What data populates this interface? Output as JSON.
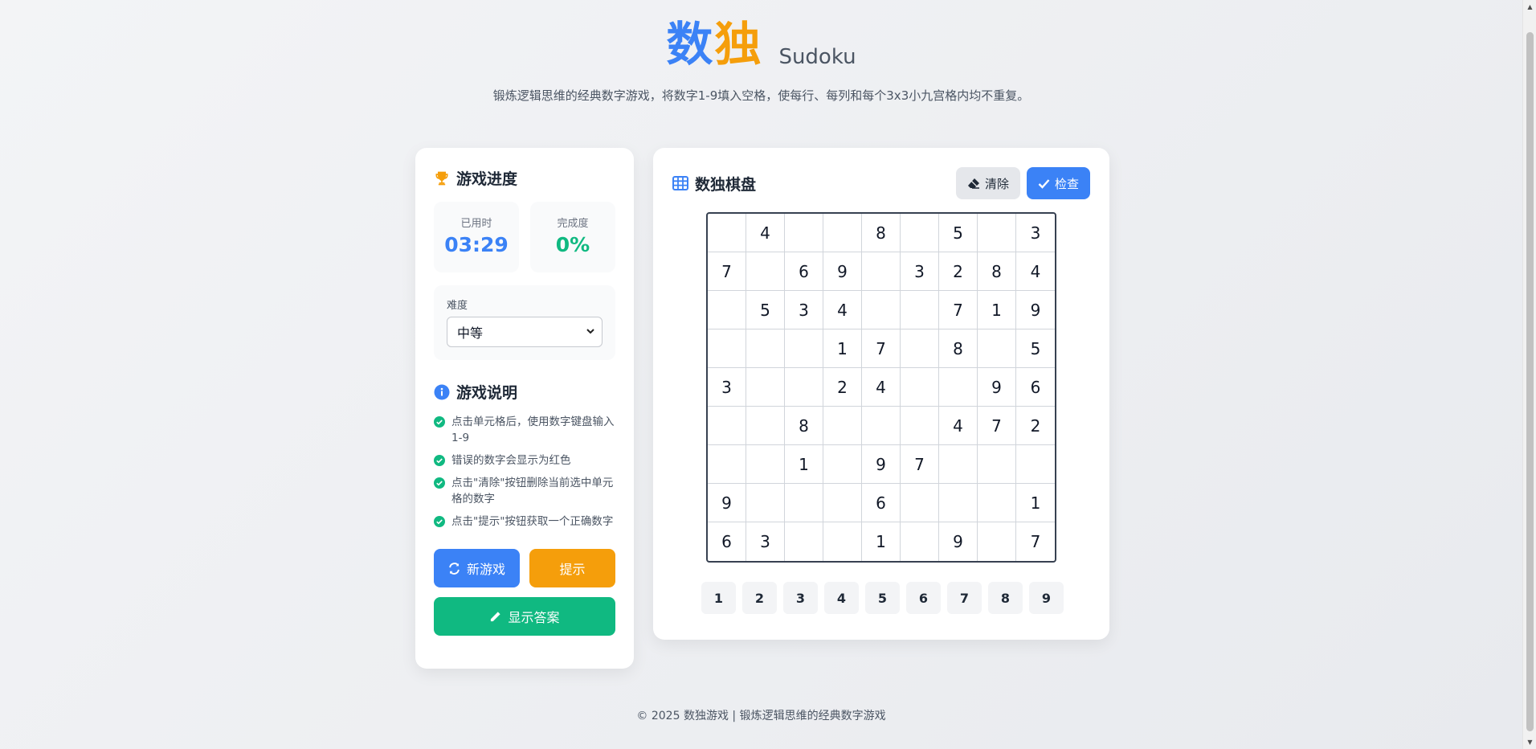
{
  "header": {
    "title_part1": "数",
    "title_part2": "独",
    "title_en": "Sudoku",
    "subtitle": "锻炼逻辑思维的经典数字游戏，将数字1-9填入空格，使每行、每列和每个3x3小九宫格内均不重复。"
  },
  "progress": {
    "title": "游戏进度",
    "icon": "trophy-icon",
    "time_label": "已用时",
    "time_value": "03:29",
    "completion_label": "完成度",
    "completion_value": "0%",
    "completion_fraction": 0
  },
  "difficulty": {
    "label": "难度",
    "selected": "中等"
  },
  "instructions": {
    "title": "游戏说明",
    "icon": "info-icon",
    "items": [
      "点击单元格后，使用数字键盘输入1-9",
      "错误的数字会显示为红色",
      "点击\"清除\"按钮删除当前选中单元格的数字",
      "点击\"提示\"按钮获取一个正确数字"
    ]
  },
  "actions": {
    "new_game": "新游戏",
    "hint": "提示",
    "show_answer": "显示答案"
  },
  "board": {
    "title": "数独棋盘",
    "icon": "grid-icon",
    "clear_label": "清除",
    "check_label": "检查",
    "rows": [
      [
        "",
        "4",
        "",
        "",
        "8",
        "",
        "5",
        "",
        "3"
      ],
      [
        "7",
        "",
        "6",
        "9",
        "",
        "3",
        "2",
        "8",
        "4"
      ],
      [
        "",
        "5",
        "3",
        "4",
        "",
        "",
        "7",
        "1",
        "9"
      ],
      [
        "",
        "",
        "",
        "1",
        "7",
        "",
        "8",
        "",
        "5"
      ],
      [
        "3",
        "",
        "",
        "2",
        "4",
        "",
        "",
        "9",
        "6"
      ],
      [
        "",
        "",
        "8",
        "",
        "",
        "",
        "4",
        "7",
        "2"
      ],
      [
        "",
        "",
        "1",
        "",
        "9",
        "7",
        "",
        "",
        ""
      ],
      [
        "9",
        "",
        "",
        "",
        "6",
        "",
        "",
        "",
        "1"
      ],
      [
        "6",
        "3",
        "",
        "",
        "1",
        "",
        "9",
        "",
        "7"
      ]
    ]
  },
  "numpad": [
    "1",
    "2",
    "3",
    "4",
    "5",
    "6",
    "7",
    "8",
    "9"
  ],
  "footer": "© 2025 数独游戏 | 锻炼逻辑思维的经典数字游戏",
  "colors": {
    "primary": "#3b82f6",
    "accent": "#f59e0b",
    "success": "#10b981"
  }
}
